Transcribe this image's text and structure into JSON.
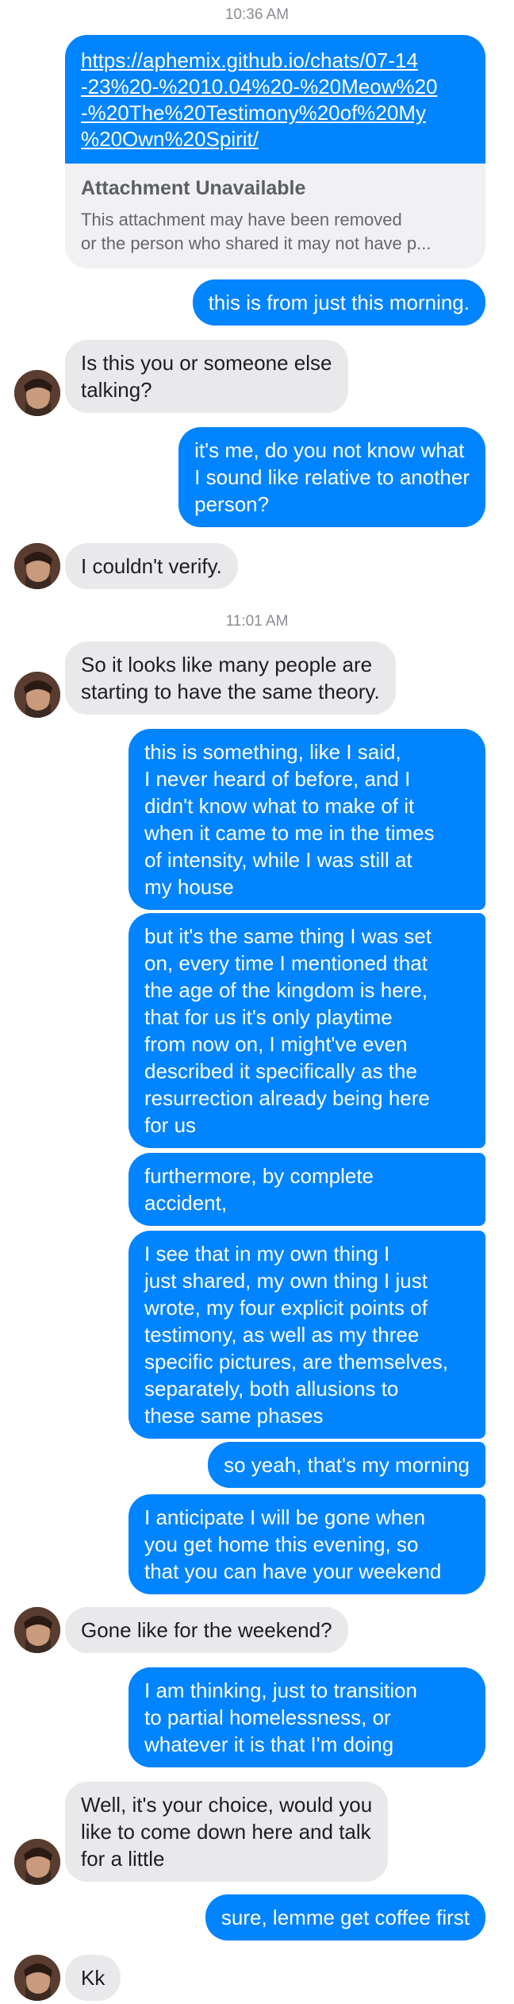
{
  "timestamps": [
    "10:36 AM",
    "11:01 AM"
  ],
  "attachment": {
    "url_lines": [
      "https://aphemix.github.io/chats/07-14",
      "-23%20-%2010.04%20-%20Meow%20",
      "-%20The%20Testimony%20of%20My",
      "%20Own%20Spirit/"
    ],
    "title": "Attachment Unavailable",
    "desc_lines": [
      "This attachment may have been removed",
      "or the person who shared it may not have p..."
    ]
  },
  "messages": [
    {
      "dir": "out",
      "lines": [
        "this is from just this morning."
      ]
    },
    {
      "dir": "in",
      "lines": [
        "Is this you or someone else",
        "talking?"
      ]
    },
    {
      "dir": "out",
      "lines": [
        "it's me, do you not know what",
        "I sound like relative to another",
        "person?"
      ]
    },
    {
      "dir": "in",
      "lines": [
        "I couldn't verify."
      ]
    },
    {
      "dir": "in",
      "lines": [
        "So it looks like many people are",
        "starting to have the same theory."
      ]
    },
    {
      "dir": "out",
      "lines": [
        "this is something, like I said,",
        "I never heard of before, and I",
        "didn't know what to make of it",
        "when it came to me in the times",
        "of intensity, while I was still at",
        "my house"
      ]
    },
    {
      "dir": "out",
      "lines": [
        "but it's the same thing I was set",
        "on, every time I mentioned that",
        "the age of the kingdom is here,",
        "that for us it's only playtime",
        "from now on, I might've even",
        "described it specifically as the",
        "resurrection already being here",
        "for us"
      ]
    },
    {
      "dir": "out",
      "lines": [
        "furthermore, by complete",
        "accident,"
      ]
    },
    {
      "dir": "out",
      "lines": [
        "I see that in my own thing I",
        "just shared, my own thing I just",
        "wrote, my four explicit points of",
        "testimony, as well as my three",
        "specific pictures, are themselves,",
        "separately, both allusions to",
        "these same phases"
      ]
    },
    {
      "dir": "out",
      "lines": [
        "so yeah, that's my morning"
      ]
    },
    {
      "dir": "out",
      "lines": [
        "I anticipate I will be gone when",
        "you get home this evening, so",
        "that you can have your weekend"
      ]
    },
    {
      "dir": "in",
      "lines": [
        "Gone like for the weekend?"
      ]
    },
    {
      "dir": "out",
      "lines": [
        "I am thinking, just to transition",
        "to partial homelessness, or",
        "whatever it is that I'm doing"
      ]
    },
    {
      "dir": "in",
      "lines": [
        "Well, it's your choice, would you",
        "like to come down here and talk",
        "for a little"
      ]
    },
    {
      "dir": "out",
      "lines": [
        "sure, lemme get coffee first"
      ]
    },
    {
      "dir": "in",
      "lines": [
        "Kk"
      ]
    }
  ],
  "colors": {
    "outgoing": "#0084ff",
    "incoming": "#e9e9eb",
    "timestamp": "#8a8d91"
  }
}
